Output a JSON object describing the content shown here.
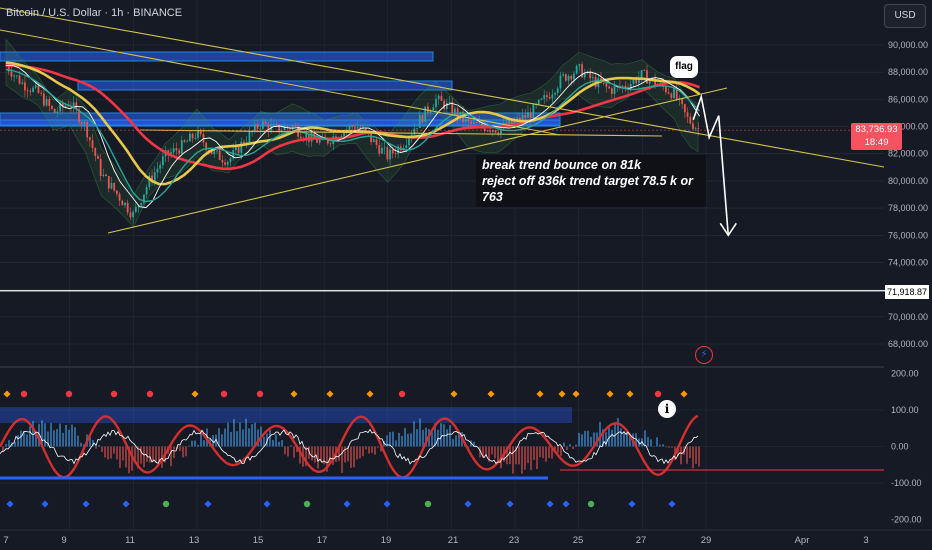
{
  "header": {
    "symbol_title": "Bitcoin / U.S. Dollar · 1h · BINANCE",
    "currency_button": "USD"
  },
  "annotations": {
    "note": "break trend bounce on 81k\nreject off 836k trend target 78.5 k or 763",
    "flag_label": "flag"
  },
  "price_tag": {
    "symbol": "BTCUSD",
    "price": "83,736.93",
    "countdown": "18:49"
  },
  "level_tag": "71,918.87",
  "colors": {
    "background": "#161a25",
    "grid": "#2a2e39",
    "trendline": "#d4c34a",
    "zone": "#2962ff",
    "ema_fast": "#f23645",
    "ema_slow": "#e6c84a",
    "bull": "#26a69a",
    "bear": "#ef5350",
    "osc": "#d32f2f"
  },
  "chart_data": [
    {
      "type": "line",
      "title": "Bitcoin / U.S. Dollar · 1h · BINANCE",
      "x_ticks": [
        "7",
        "9",
        "11",
        "13",
        "15",
        "17",
        "19",
        "21",
        "23",
        "25",
        "27",
        "29",
        "Apr",
        "3"
      ],
      "y_ticks": [
        "90,000.00",
        "88,000.00",
        "86,000.00",
        "84,000.00",
        "82,000.00",
        "80,000.00",
        "78,000.00",
        "76,000.00",
        "74,000.00",
        "70,000.00",
        "68,000.00"
      ],
      "ylim": [
        66500,
        91500
      ],
      "series": [
        {
          "x": [
            7,
            7.5,
            8,
            8.5,
            9,
            9.5,
            10,
            10.5,
            11,
            11.5,
            12,
            12.5,
            13,
            13.5,
            14,
            14.5,
            15,
            15.5,
            16,
            16.5,
            17,
            17.5,
            18,
            18.5,
            19,
            19.5,
            20,
            20.5,
            21,
            21.5,
            22,
            22.5,
            23,
            23.5,
            24,
            24.5,
            25,
            25.5,
            26,
            26.5,
            27,
            27.5,
            28,
            28.4,
            28.8
          ],
          "values": [
            88500,
            87200,
            86500,
            85000,
            85800,
            84000,
            80500,
            79000,
            77500,
            80000,
            81800,
            82500,
            83500,
            82000,
            81500,
            83000,
            84200,
            83800,
            84000,
            83200,
            82800,
            83600,
            84100,
            83000,
            81800,
            82800,
            84500,
            86000,
            85300,
            84200,
            84000,
            83800,
            84300,
            85000,
            86200,
            87600,
            88200,
            87300,
            86700,
            87000,
            87800,
            87100,
            86400,
            84600,
            83737
          ]
        }
      ],
      "horizontal_level": 71918.87,
      "projection": {
        "x": [
          28.6,
          28.85,
          29.1,
          29.4,
          29.7
        ],
        "values": [
          84500,
          86200,
          83200,
          84800,
          76000
        ]
      }
    },
    {
      "type": "line",
      "title": "",
      "y_ticks": [
        "200.00",
        "100.00",
        "0.00",
        "-100.00",
        "-200.00"
      ],
      "ylim": [
        -230,
        230
      ]
    }
  ]
}
